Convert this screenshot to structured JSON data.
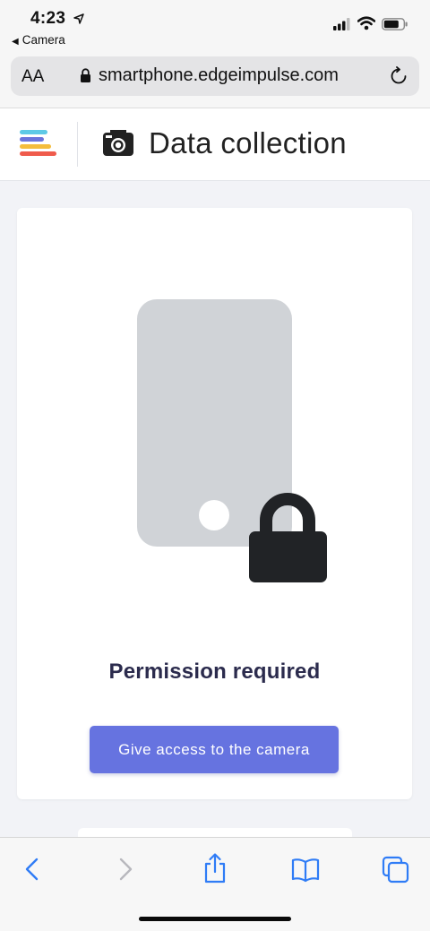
{
  "status_bar": {
    "time": "4:23",
    "back_app_label": "Camera",
    "icons": [
      "location-arrow-icon",
      "signal-icon",
      "wifi-icon",
      "battery-icon"
    ]
  },
  "browser": {
    "text_size_label": "AA",
    "url": "smartphone.edgeimpulse.com",
    "icons": [
      "lock-icon",
      "reload-icon"
    ]
  },
  "app_header": {
    "title": "Data collection",
    "icons": [
      "edge-impulse-logo-icon",
      "camera-icon"
    ]
  },
  "card": {
    "illustration_icons": [
      "phone-icon",
      "padlock-icon"
    ],
    "permission_text": "Permission required",
    "button_label": "Give access to the camera"
  },
  "toolbar": {
    "icons": [
      "back-icon",
      "forward-icon",
      "share-icon",
      "bookmarks-icon",
      "tabs-icon"
    ]
  },
  "colors": {
    "accent": "#6673e0",
    "heading": "#2b2b4d",
    "illustration_gray": "#d0d3d7",
    "lock_dark": "#212326",
    "ios_blue": "#2f7cf6"
  }
}
